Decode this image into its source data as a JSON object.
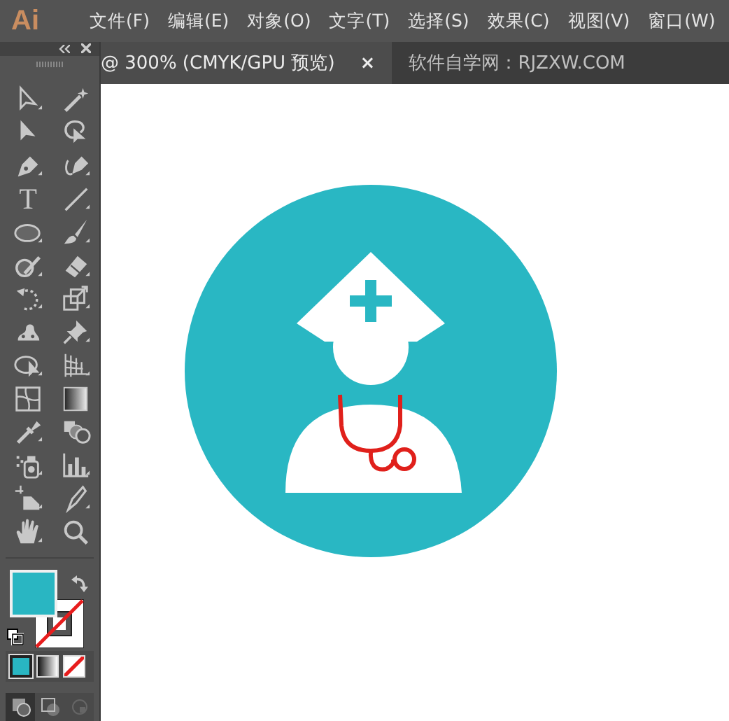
{
  "app": {
    "logo": "Ai"
  },
  "menu": [
    {
      "label": "文件(F)"
    },
    {
      "label": "编辑(E)"
    },
    {
      "label": "对象(O)"
    },
    {
      "label": "文字(T)"
    },
    {
      "label": "选择(S)"
    },
    {
      "label": "效果(C)"
    },
    {
      "label": "视图(V)"
    },
    {
      "label": "窗口(W)"
    }
  ],
  "tools_panel": {
    "type_tool": "T"
  },
  "tabs": [
    {
      "label": "@ 300% (CMYK/GPU 预览)",
      "selected": true,
      "close": "×"
    },
    {
      "label": "软件自学网：RJZXW.COM",
      "selected": false
    }
  ]
}
